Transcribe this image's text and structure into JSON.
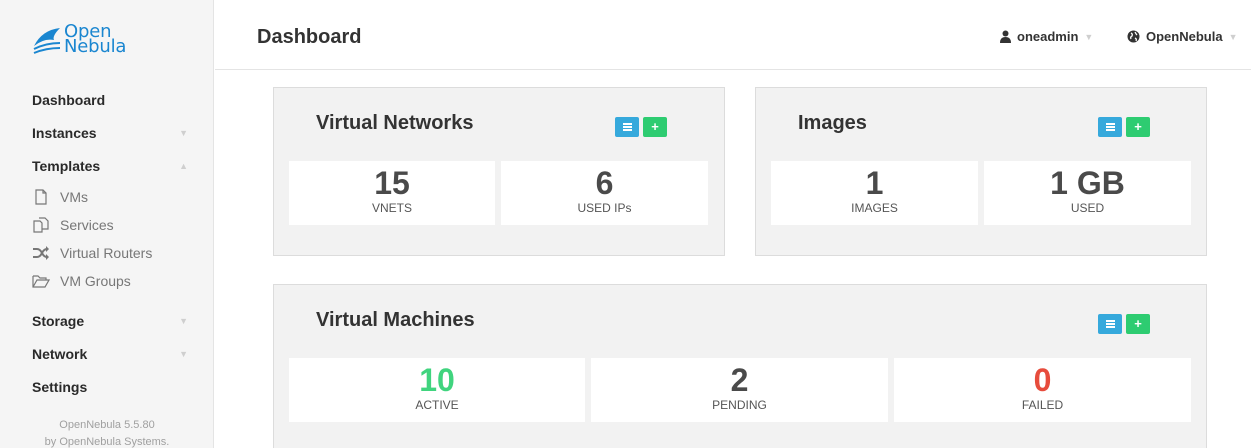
{
  "app": {
    "logo_text_line1": "Open",
    "logo_text_line2": "Nebula",
    "page_title": "Dashboard",
    "user": "oneadmin",
    "zone": "OpenNebula"
  },
  "sidebar": {
    "items": [
      {
        "label": "Dashboard"
      },
      {
        "label": "Instances"
      },
      {
        "label": "Templates"
      },
      {
        "label": "VMs"
      },
      {
        "label": "Services"
      },
      {
        "label": "Virtual Routers"
      },
      {
        "label": "VM Groups"
      },
      {
        "label": "Storage"
      },
      {
        "label": "Network"
      },
      {
        "label": "Settings"
      }
    ],
    "footer_version": "OpenNebula 5.5.80",
    "footer_by": "by",
    "footer_company": "OpenNebula Systems."
  },
  "panels": {
    "vnets": {
      "title": "Virtual Networks",
      "stats": [
        {
          "value": "15",
          "label": "VNETS"
        },
        {
          "value": "6",
          "label": "USED IPs"
        }
      ]
    },
    "images": {
      "title": "Images",
      "stats": [
        {
          "value": "1",
          "label": "IMAGES"
        },
        {
          "value": "1 GB",
          "label": "USED"
        }
      ]
    },
    "vms": {
      "title": "Virtual Machines",
      "stats": [
        {
          "value": "10",
          "label": "ACTIVE"
        },
        {
          "value": "2",
          "label": "PENDING"
        },
        {
          "value": "0",
          "label": "FAILED"
        }
      ]
    }
  },
  "icons": {
    "list_button": "list-icon",
    "add_button": "plus-icon",
    "user": "user-icon",
    "zone": "globe-icon"
  },
  "colors": {
    "brand": "#1a86d0",
    "list_button": "#36a9dc",
    "add_button": "#2ecc71",
    "active": "#40d47e",
    "failed": "#e74c3c"
  }
}
